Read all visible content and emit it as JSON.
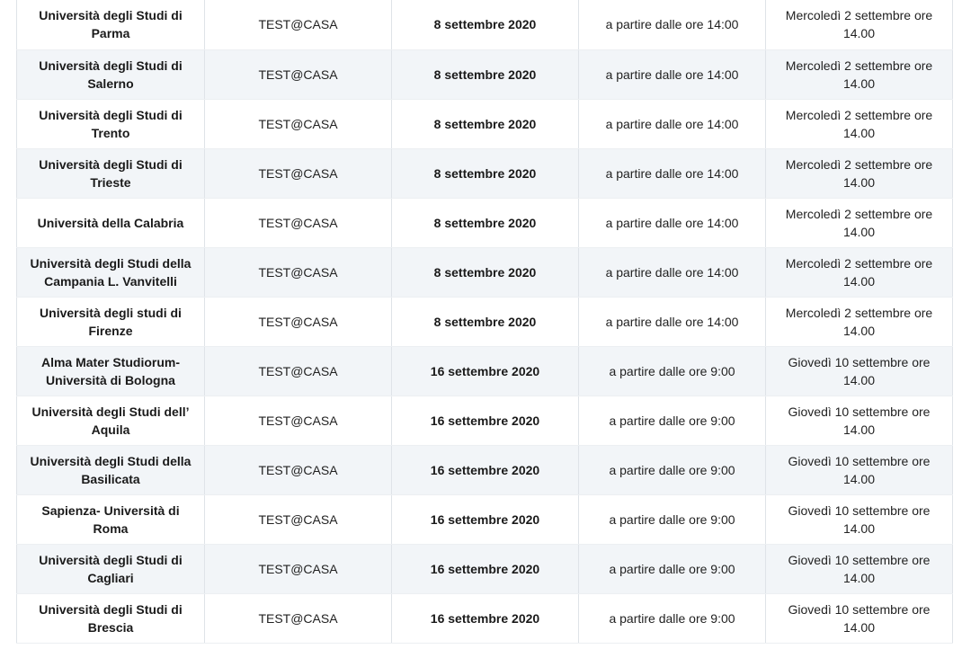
{
  "table": {
    "rows": [
      {
        "university": "Università degli Studi di Parma",
        "mode": "TEST@CASA",
        "date": "8 settembre 2020",
        "time": "a partire dalle ore 14:00",
        "registration": "Mercoledì 2 settembre ore 14.00"
      },
      {
        "university": "Università degli Studi di Salerno",
        "mode": "TEST@CASA",
        "date": "8 settembre 2020",
        "time": "a partire dalle ore 14:00",
        "registration": "Mercoledì 2 settembre ore 14.00"
      },
      {
        "university": "Università degli Studi di Trento",
        "mode": "TEST@CASA",
        "date": "8 settembre 2020",
        "time": "a partire dalle ore 14:00",
        "registration": "Mercoledì 2 settembre ore 14.00"
      },
      {
        "university": "Università degli Studi di Trieste",
        "mode": "TEST@CASA",
        "date": "8 settembre 2020",
        "time": "a partire dalle ore 14:00",
        "registration": "Mercoledì 2 settembre ore 14.00"
      },
      {
        "university": "Università della Calabria",
        "mode": "TEST@CASA",
        "date": "8 settembre 2020",
        "time": "a partire dalle ore 14:00",
        "registration": "Mercoledì 2 settembre ore 14.00"
      },
      {
        "university": "Università degli Studi della Campania L. Vanvitelli",
        "mode": "TEST@CASA",
        "date": "8 settembre 2020",
        "time": "a partire dalle ore 14:00",
        "registration": "Mercoledì 2 settembre ore 14.00"
      },
      {
        "university": "Università degli studi di Firenze",
        "mode": "TEST@CASA",
        "date": "8 settembre 2020",
        "time": "a partire dalle ore 14:00",
        "registration": "Mercoledì 2 settembre ore 14.00"
      },
      {
        "university": "Alma Mater Studiorum- Università di Bologna",
        "mode": "TEST@CASA",
        "date": "16 settembre 2020",
        "time": "a partire dalle ore 9:00",
        "registration": "Giovedì 10 settembre ore 14.00"
      },
      {
        "university": "Università degli Studi dell’ Aquila",
        "mode": "TEST@CASA",
        "date": "16 settembre 2020",
        "time": "a partire dalle ore 9:00",
        "registration": "Giovedì 10 settembre ore 14.00"
      },
      {
        "university": "Università degli Studi della Basilicata",
        "mode": "TEST@CASA",
        "date": "16 settembre 2020",
        "time": "a partire dalle ore 9:00",
        "registration": "Giovedì 10 settembre ore 14.00"
      },
      {
        "university": "Sapienza- Università di Roma",
        "mode": "TEST@CASA",
        "date": "16 settembre 2020",
        "time": "a partire dalle ore 9:00",
        "registration": "Giovedì 10 settembre ore 14.00"
      },
      {
        "university": "Università degli Studi di Cagliari",
        "mode": "TEST@CASA",
        "date": "16 settembre 2020",
        "time": "a partire dalle ore 9:00",
        "registration": "Giovedì 10 settembre ore 14.00"
      },
      {
        "university": "Università degli Studi di Brescia",
        "mode": "TEST@CASA",
        "date": "16 settembre 2020",
        "time": "a partire dalle ore 9:00",
        "registration": "Giovedì 10 settembre ore 14.00"
      }
    ]
  }
}
